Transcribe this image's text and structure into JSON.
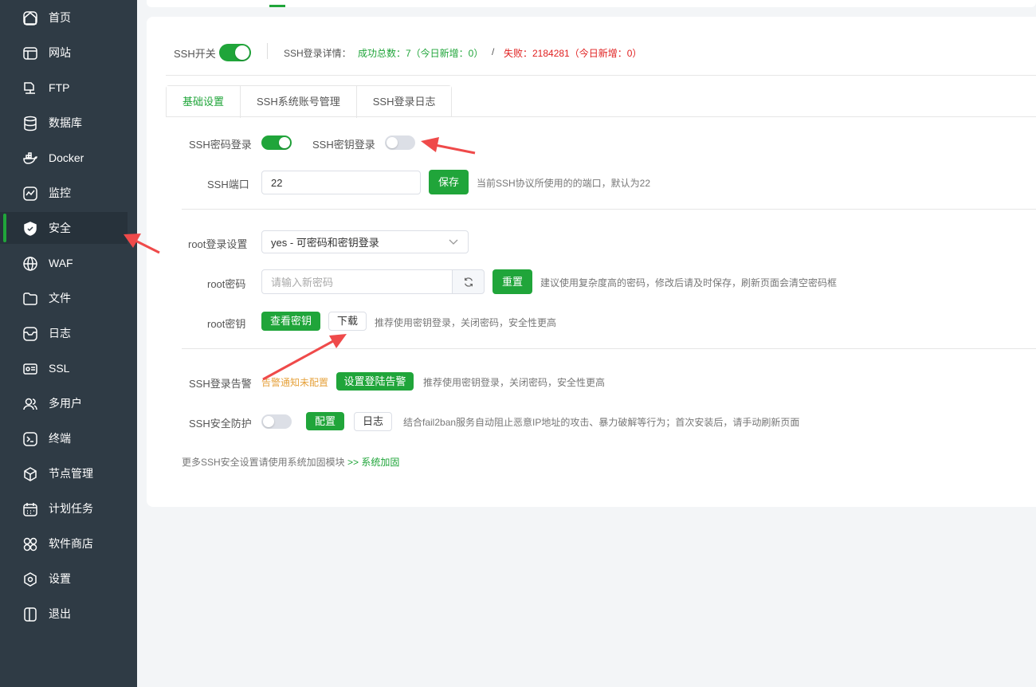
{
  "sidebar": {
    "items": [
      {
        "label": "首页",
        "icon": "home-icon"
      },
      {
        "label": "网站",
        "icon": "website-icon"
      },
      {
        "label": "FTP",
        "icon": "ftp-icon"
      },
      {
        "label": "数据库",
        "icon": "database-icon"
      },
      {
        "label": "Docker",
        "icon": "docker-icon"
      },
      {
        "label": "监控",
        "icon": "monitor-icon"
      },
      {
        "label": "安全",
        "icon": "shield-icon"
      },
      {
        "label": "WAF",
        "icon": "globe-icon"
      },
      {
        "label": "文件",
        "icon": "folder-icon"
      },
      {
        "label": "日志",
        "icon": "log-icon"
      },
      {
        "label": "SSL",
        "icon": "certificate-icon"
      },
      {
        "label": "多用户",
        "icon": "users-icon"
      },
      {
        "label": "终端",
        "icon": "terminal-icon"
      },
      {
        "label": "节点管理",
        "icon": "cube-icon"
      },
      {
        "label": "计划任务",
        "icon": "calendar-icon"
      },
      {
        "label": "软件商店",
        "icon": "apps-icon"
      },
      {
        "label": "设置",
        "icon": "settings-icon"
      },
      {
        "label": "退出",
        "icon": "logout-icon"
      }
    ],
    "active_index": 6
  },
  "header": {
    "ssh_switch_label": "SSH开关",
    "ssh_switch_on": true,
    "login_details_label": "SSH登录详情：",
    "success_text": "成功总数：7（今日新增：0）",
    "separator": "/",
    "fail_text": "失败：2184281（今日新增：0）"
  },
  "tabs": [
    {
      "label": "基础设置",
      "active": true
    },
    {
      "label": "SSH系统账号管理",
      "active": false
    },
    {
      "label": "SSH登录日志",
      "active": false
    }
  ],
  "basic": {
    "password_login_label": "SSH密码登录",
    "password_login_on": true,
    "key_login_label": "SSH密钥登录",
    "key_login_on": false,
    "port_label": "SSH端口",
    "port_value": "22",
    "save_label": "保存",
    "port_hint": "当前SSH协议所使用的的端口，默认为22",
    "root_login_label": "root登录设置",
    "root_login_value": "yes - 可密码和密钥登录",
    "root_password_label": "root密码",
    "root_password_placeholder": "请输入新密码",
    "reset_label": "重置",
    "root_password_hint": "建议使用复杂度高的密码，修改后请及时保存，刷新页面会清空密码框",
    "root_key_label": "root密钥",
    "view_key_label": "查看密钥",
    "download_label": "下载",
    "root_key_hint": "推荐使用密钥登录，关闭密码，安全性更高",
    "alert_label": "SSH登录告警",
    "alert_status": "告警通知未配置",
    "alert_button": "设置登陆告警",
    "alert_hint": "推荐使用密钥登录，关闭密码，安全性更高",
    "protect_label": "SSH安全防护",
    "protect_on": false,
    "config_label": "配置",
    "log_label": "日志",
    "protect_hint": "结合fail2ban服务自动阻止恶意IP地址的攻击、暴力破解等行为；首次安装后，请手动刷新页面",
    "more_text": "更多SSH安全设置请使用系统加固模块",
    "more_link": ">> 系统加固"
  },
  "colors": {
    "accent": "#20a53a",
    "error": "#e02020",
    "warning": "#e6a23c",
    "sidebar_bg": "#2f3b45",
    "arrow": "#ef4a4a"
  }
}
